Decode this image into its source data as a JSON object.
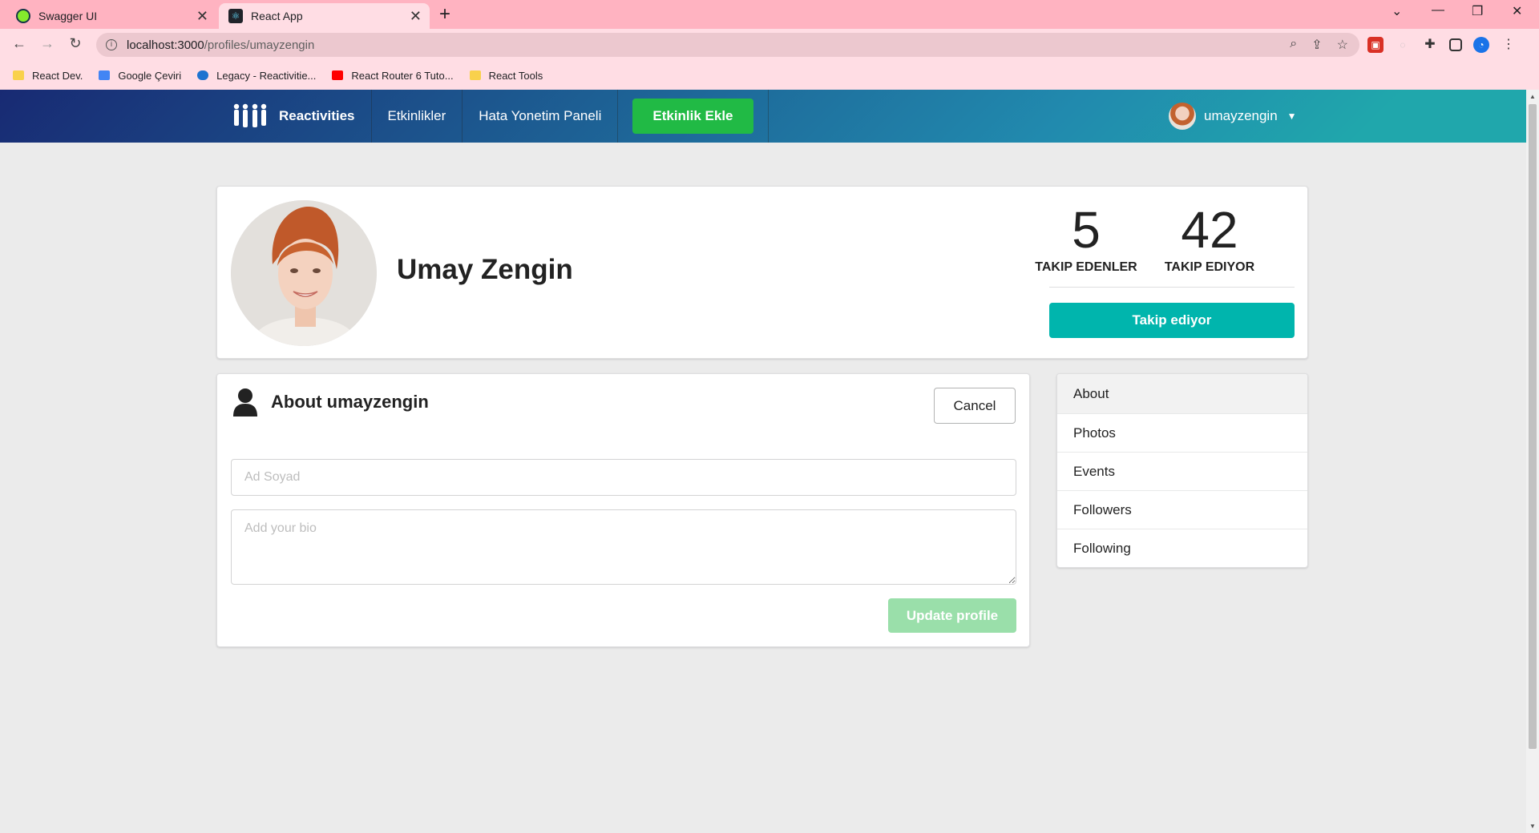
{
  "browser": {
    "tabs": [
      {
        "title": "Swagger UI"
      },
      {
        "title": "React App"
      }
    ],
    "url_host": "localhost:3000",
    "url_path": "/profiles/umayzengin",
    "bookmarks": [
      {
        "label": "React Dev.",
        "color": "#f9d14c"
      },
      {
        "label": "Google Çeviri",
        "color": "#4285f4"
      },
      {
        "label": "Legacy - Reactivitie...",
        "color": "#1e73d0"
      },
      {
        "label": "React Router 6 Tuto...",
        "color": "#ff0000"
      },
      {
        "label": "React Tools",
        "color": "#f9d14c"
      }
    ]
  },
  "navbar": {
    "brand": "Reactivities",
    "items": [
      {
        "label": "Etkinlikler"
      },
      {
        "label": "Hata Yonetim Paneli"
      }
    ],
    "create_button": "Etkinlik Ekle",
    "username": "umayzengin"
  },
  "profile": {
    "display_name": "Umay Zengin",
    "followers_count": "5",
    "followers_label": "TAKIP EDENLER",
    "following_count": "42",
    "following_label": "TAKIP EDIYOR",
    "follow_button": "Takip ediyor"
  },
  "about": {
    "title": "About umayzengin",
    "cancel_button": "Cancel",
    "name_placeholder": "Ad Soyad",
    "bio_placeholder": "Add your bio",
    "update_button": "Update profile"
  },
  "side_menu": {
    "items": [
      {
        "label": "About"
      },
      {
        "label": "Photos"
      },
      {
        "label": "Events"
      },
      {
        "label": "Followers"
      },
      {
        "label": "Following"
      }
    ]
  },
  "colors": {
    "accent_teal": "#00b5ad",
    "accent_green": "#21ba45",
    "nav_gradient_start": "#182a73",
    "nav_gradient_end": "#20a7ac"
  }
}
